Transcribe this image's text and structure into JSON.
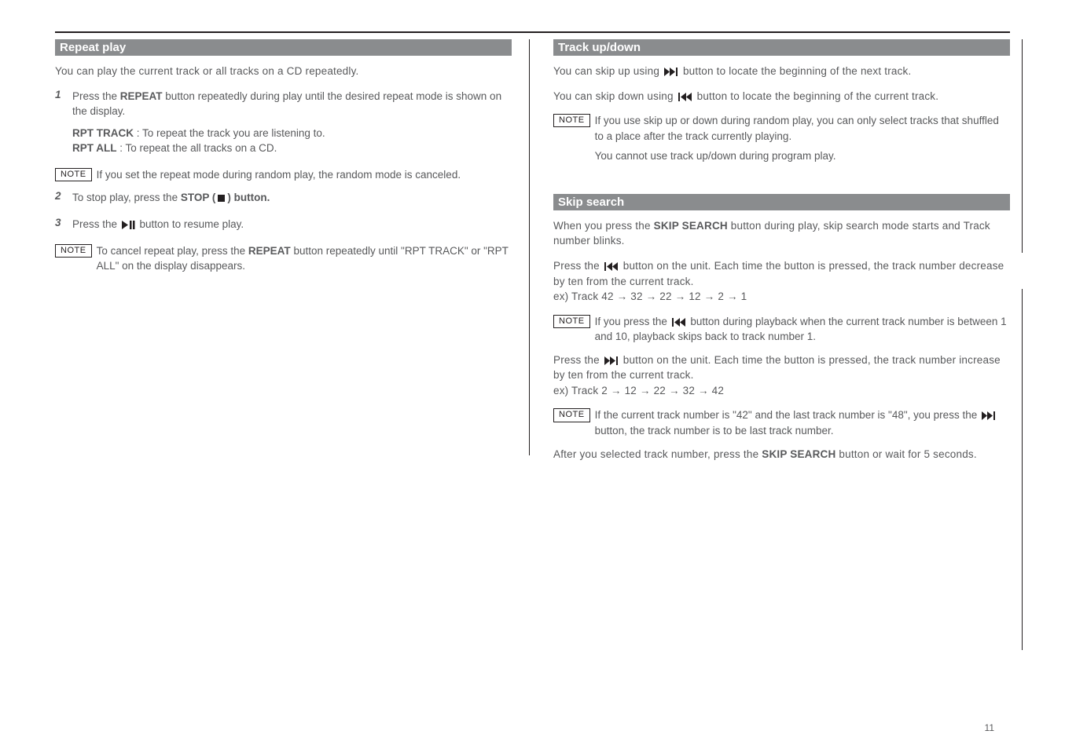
{
  "noteLabel": "NOTE",
  "left": {
    "header": "Repeat play",
    "intro": "You can play the current track or all tracks on a CD repeatedly.",
    "step1_num": "1",
    "step1a": "Press the ",
    "step1b": "REPEAT",
    "step1c": " button repeatedly during play until the desired repeat mode is shown on the display.",
    "rpt_line1a": "RPT TRACK",
    "rpt_line1b": " : To repeat the track you are listening to.",
    "rpt_line2a": "RPT ALL",
    "rpt_line2b": " : To repeat the all tracks on a CD.",
    "note_line1": "If you set the repeat mode during random play, the random mode is canceled.",
    "step2_num": "2",
    "step2a": "To stop play, press the ",
    "step2b": "STOP (",
    "step2c": ") button.",
    "step3_num": "3",
    "step3a": "Press the ",
    "step3b": " button to resume play.",
    "note_line2a": "To cancel repeat play, press the ",
    "note_line2b": "REPEAT",
    "note_line2c": " button repeatedly until \"RPT TRACK\" or \"RPT ALL\" on the display disappears."
  },
  "right1": {
    "header": "Track up/down",
    "l1a": "You can skip up using ",
    "l1b": " button to locate the beginning of the next track.",
    "l2a": "You can skip down using ",
    "l2b": " button to locate the beginning of the current track.",
    "note1": "If you use skip up or down during random play, you can only select tracks that shuffled to a place after the track currently playing.",
    "note2": "You cannot use track up/down during program play."
  },
  "right2": {
    "header": "Skip search",
    "l1a": "When you press the ",
    "l1b": "SKIP SEARCH",
    "l1c": " button during play, skip search mode starts and Track number blinks.",
    "l2a": "Press the ",
    "l2b": " button on the unit. Each time the button is pressed, the track number decrease by ten from the current track.",
    "l2c": "ex) Track 42 → 32 → 22 → 12 → 2 → 1",
    "note1a": "If you press the ",
    "note1b": " button during playback when the current track number is between 1 and 10, playback skips back to track number 1.",
    "l3a": "Press the ",
    "l3b": " button on the unit. Each time the button is pressed, the track number increase by ten from the current track.",
    "l3c": "ex) Track 2 → 12 → 22 → 32 → 42",
    "note2a": "If the current track number is \"42\" and the last track number is \"48\", you press the ",
    "note2b": " button, the track number is to be last track number.",
    "l4a": "After you selected track number, press the ",
    "l4b": "SKIP SEARCH",
    "l4c": " button or wait for 5 seconds."
  },
  "pageNumber": "11"
}
